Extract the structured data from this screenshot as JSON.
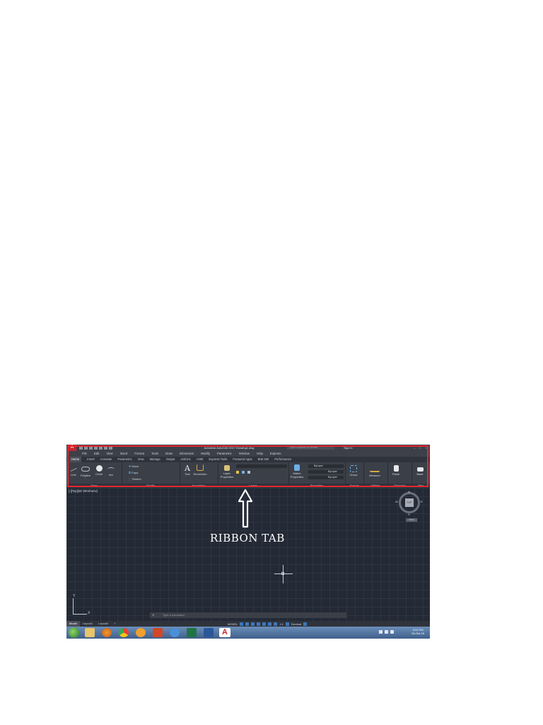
{
  "titlebar": {
    "app_title": "Autodesk AutoCAD 2017   Drawing1.dwg",
    "search_placeholder": "Type a keyword or phrase",
    "signin": "Sign In"
  },
  "menu": [
    "File",
    "Edit",
    "View",
    "Insert",
    "Format",
    "Tools",
    "Draw",
    "Dimension",
    "Modify",
    "Parametric",
    "Window",
    "Help",
    "Express"
  ],
  "tabs": [
    "Home",
    "Insert",
    "Annotate",
    "Parametric",
    "View",
    "Manage",
    "Output",
    "Add-ins",
    "A360",
    "Express Tools",
    "Featured Apps",
    "BIM 360",
    "Performance"
  ],
  "panels": {
    "draw": {
      "label": "Draw",
      "tools": [
        "Line",
        "Polyline",
        "Circle",
        "Arc"
      ]
    },
    "modify": {
      "label": "Modify",
      "tools": [
        "Move",
        "Copy",
        "Stretch"
      ]
    },
    "annotation": {
      "label": "Annotation",
      "tools": [
        "Text",
        "Dimension"
      ]
    },
    "layers": {
      "label": "Layers",
      "tools": [
        "Layer Properties"
      ]
    },
    "properties": {
      "label": "Properties",
      "tools": [
        "Match Properties"
      ],
      "values": [
        "ByLayer",
        "ByLayer",
        "ByLayer"
      ]
    },
    "groups": {
      "label": "Groups",
      "tools": [
        "Group"
      ]
    },
    "utilities": {
      "label": "Utilities",
      "tools": [
        "Measure"
      ]
    },
    "clipboard": {
      "label": "Clipboard",
      "tools": [
        "Paste"
      ]
    },
    "view": {
      "label": "View",
      "tools": [
        "Base"
      ]
    }
  },
  "viewport": {
    "label": "[-][Top][2D Wireframe]",
    "compass": {
      "n": "N",
      "s": "S",
      "e": "E",
      "w": "W",
      "top": "TOP"
    },
    "wcs": "WCS",
    "ucs_x": "X",
    "ucs_y": "Y"
  },
  "command_line": {
    "placeholder": "Type a command"
  },
  "layout_tabs": [
    "Model",
    "Layout1",
    "Layout2",
    "+"
  ],
  "status": {
    "mode": "MODEL",
    "scale": "1:1",
    "units": "Decimal"
  },
  "clock": {
    "time": "3:31 PM",
    "date": "04-Oct-18"
  },
  "annotation": {
    "label": "RIBBON TAB"
  },
  "colors": {
    "highlight": "#e8262d",
    "dark_bg": "#232a35",
    "ribbon_bg": "#3b3f48"
  }
}
